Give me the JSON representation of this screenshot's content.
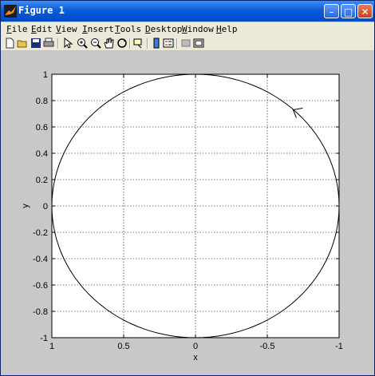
{
  "window": {
    "title": "Figure 1"
  },
  "menu": [
    {
      "label": "File",
      "accel": "F",
      "rest": "ile"
    },
    {
      "label": "Edit",
      "accel": "E",
      "rest": "dit"
    },
    {
      "label": "View",
      "accel": "V",
      "rest": "iew"
    },
    {
      "label": "Insert",
      "accel": "I",
      "rest": "nsert"
    },
    {
      "label": "Tools",
      "accel": "T",
      "rest": "ools"
    },
    {
      "label": "Desktop",
      "accel": "D",
      "rest": "esktop"
    },
    {
      "label": "Window",
      "accel": "W",
      "rest": "indow"
    },
    {
      "label": "Help",
      "accel": "H",
      "rest": "elp"
    }
  ],
  "toolbar": {
    "icons": [
      "new-file-icon",
      "open-folder-icon",
      "save-icon",
      "print-icon",
      "pointer-icon",
      "zoom-in-icon",
      "zoom-out-icon",
      "pan-hand-icon",
      "rotate-3d-icon",
      "data-cursor-icon",
      "colorbar-icon",
      "legend-icon",
      "hide-plot-tools-icon",
      "show-plot-tools-icon"
    ]
  },
  "chart_data": {
    "type": "line",
    "title": "",
    "xlabel": "x",
    "ylabel": "y",
    "xlim": [
      1,
      -1
    ],
    "ylim": [
      -1,
      1
    ],
    "x_reversed": true,
    "grid": true,
    "xticks": [
      1,
      0.5,
      0,
      -0.5,
      -1
    ],
    "xtick_labels": [
      "1",
      "0.5",
      "0",
      "-0.5",
      "-1"
    ],
    "yticks": [
      -1,
      -0.8,
      -0.6,
      -0.4,
      -0.2,
      0,
      0.2,
      0.4,
      0.6,
      0.8,
      1
    ],
    "ytick_labels": [
      "-1",
      "-0.8",
      "-0.6",
      "-0.4",
      "-0.2",
      "0",
      "0.2",
      "0.4",
      "0.6",
      "0.8",
      "1"
    ],
    "series": [
      {
        "curve": "unit circle x=cos(t), y=sin(t)",
        "samples": 120,
        "color": "#000000"
      }
    ],
    "annotations": [
      {
        "type": "direction-arrow",
        "x": -0.68,
        "y": 0.73
      }
    ]
  }
}
